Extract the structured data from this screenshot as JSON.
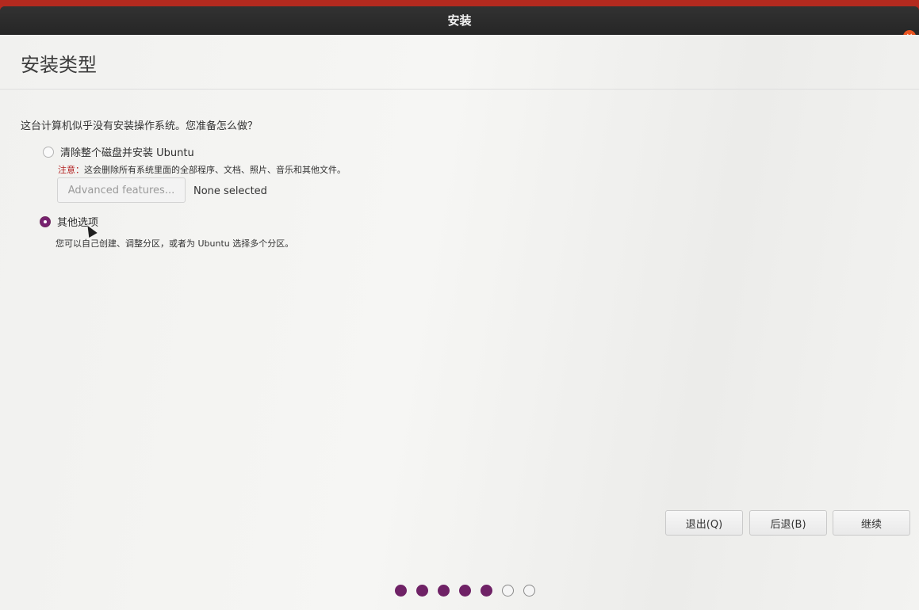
{
  "window": {
    "title": "安装",
    "close_icon": "close-icon",
    "close_glyph": "×"
  },
  "page": {
    "title": "安装类型",
    "question": "这台计算机似乎没有安装操作系统。您准备怎么做？"
  },
  "options": [
    {
      "label": "清除整个磁盘并安装 Ubuntu",
      "checked": false,
      "note_prefix": "注意：",
      "note_text": "这会删除所有系统里面的全部程序、文档、照片、音乐和其他文件。"
    },
    {
      "label": "其他选项",
      "checked": true,
      "description": "您可以自己创建、调整分区，或者为 Ubuntu 选择多个分区。"
    }
  ],
  "advanced": {
    "button_label": "Advanced features...",
    "status": "None selected"
  },
  "footer": {
    "quit_label": "退出(Q)",
    "back_label": "后退(B)",
    "continue_label": "继续"
  },
  "progress": {
    "total_steps": 7,
    "completed_steps": 5
  },
  "colors": {
    "accent": "#77216f",
    "warning": "#b21f1f",
    "close": "#e95420",
    "desktop": "#b42a1f"
  }
}
